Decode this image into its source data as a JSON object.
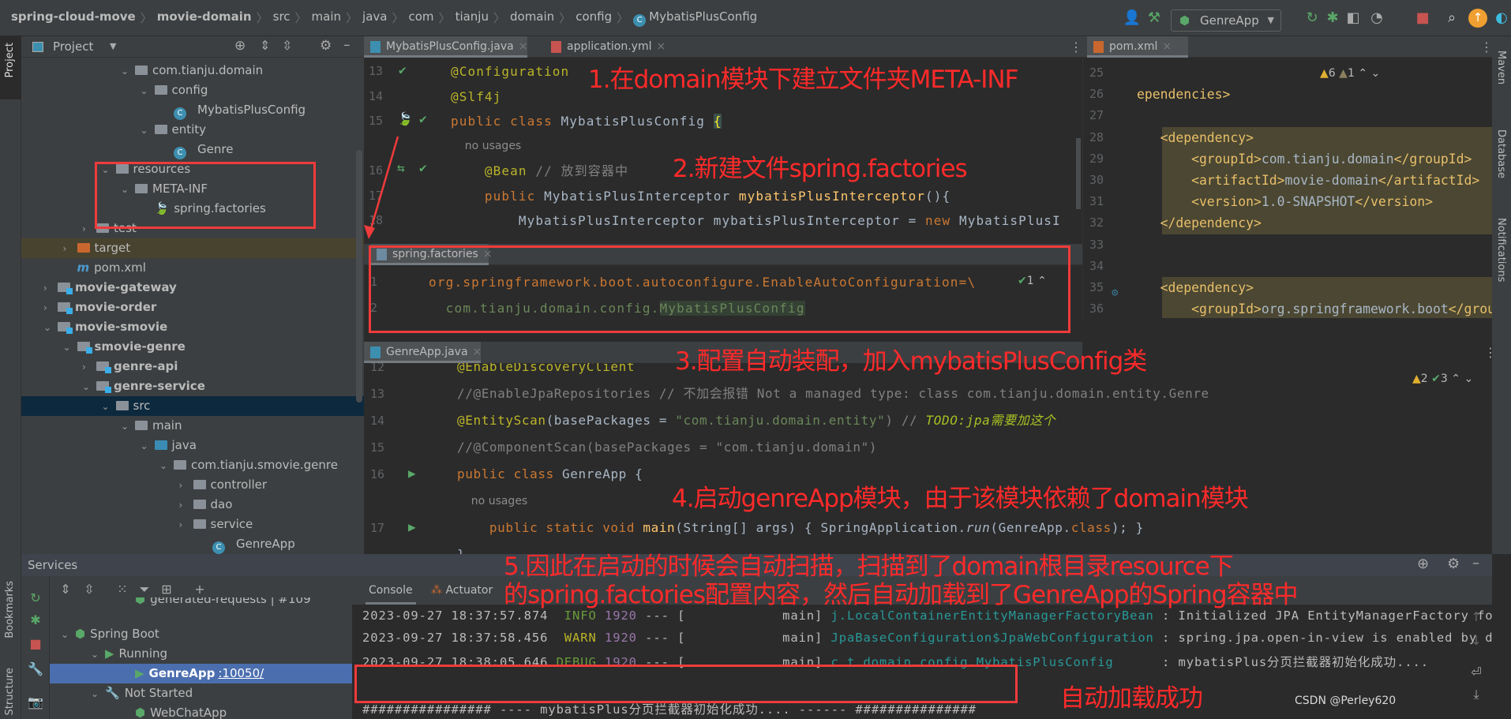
{
  "breadcrumb": [
    "spring-cloud-move",
    "movie-domain",
    "src",
    "main",
    "java",
    "com",
    "tianju",
    "domain",
    "config",
    "MybatisPlusConfig"
  ],
  "toolbar": {
    "run_config": "GenreApp"
  },
  "left_stripe": {
    "project": "Project",
    "bookmarks": "Bookmarks",
    "structure": "Structure"
  },
  "right_stripe": {
    "maven": "Maven",
    "database": "Database",
    "notifications": "Notifications"
  },
  "project_panel": {
    "title": "Project",
    "tree": [
      {
        "label": "com.tianju.domain",
        "level": 4,
        "expanded": true,
        "icon": "package"
      },
      {
        "label": "config",
        "level": 5,
        "expanded": true,
        "icon": "package"
      },
      {
        "label": "MybatisPlusConfig",
        "level": 6,
        "icon": "class"
      },
      {
        "label": "entity",
        "level": 5,
        "expanded": true,
        "icon": "package"
      },
      {
        "label": "Genre",
        "level": 6,
        "icon": "class"
      },
      {
        "label": "resources",
        "level": 3,
        "expanded": true,
        "icon": "resources-folder"
      },
      {
        "label": "META-INF",
        "level": 4,
        "expanded": true,
        "icon": "folder"
      },
      {
        "label": "spring.factories",
        "level": 5,
        "icon": "spring"
      },
      {
        "label": "test",
        "level": 2,
        "expanded": false,
        "icon": "folder"
      },
      {
        "label": "target",
        "level": 1,
        "expanded": false,
        "icon": "excluded-folder",
        "highlight": "target"
      },
      {
        "label": "pom.xml",
        "level": 1,
        "icon": "maven"
      },
      {
        "label": "movie-gateway",
        "level": 0,
        "expanded": false,
        "icon": "module",
        "bold": true
      },
      {
        "label": "movie-order",
        "level": 0,
        "expanded": false,
        "icon": "module",
        "bold": true
      },
      {
        "label": "movie-smovie",
        "level": 0,
        "expanded": true,
        "icon": "module",
        "bold": true
      },
      {
        "label": "smovie-genre",
        "level": 1,
        "expanded": true,
        "icon": "module",
        "bold": true
      },
      {
        "label": "genre-api",
        "level": 2,
        "expanded": false,
        "icon": "module",
        "bold": true
      },
      {
        "label": "genre-service",
        "level": 2,
        "expanded": true,
        "icon": "module",
        "bold": true
      },
      {
        "label": "src",
        "level": 3,
        "expanded": true,
        "icon": "folder",
        "highlight": "selected"
      },
      {
        "label": "main",
        "level": 4,
        "expanded": true,
        "icon": "folder"
      },
      {
        "label": "java",
        "level": 5,
        "expanded": true,
        "icon": "source-folder"
      },
      {
        "label": "com.tianju.smovie.genre",
        "level": 6,
        "expanded": true,
        "icon": "package"
      },
      {
        "label": "controller",
        "level": 7,
        "expanded": false,
        "icon": "package"
      },
      {
        "label": "dao",
        "level": 7,
        "expanded": false,
        "icon": "package"
      },
      {
        "label": "service",
        "level": 7,
        "expanded": false,
        "icon": "package"
      },
      {
        "label": "GenreApp",
        "level": 8,
        "icon": "spring-boot-class"
      }
    ]
  },
  "editor_top": {
    "tabs": [
      {
        "label": "MybatisPlusConfig.java",
        "active": true
      },
      {
        "label": "application.yml"
      }
    ],
    "lines": [
      {
        "num": "13",
        "tokens": [
          [
            "@Configuration",
            "ann"
          ]
        ]
      },
      {
        "num": "14",
        "tokens": [
          [
            "@Slf4j",
            "ann"
          ]
        ]
      },
      {
        "num": "15",
        "tokens": [
          [
            "public ",
            "kw"
          ],
          [
            "class ",
            "kw"
          ],
          [
            "MybatisPlusConfig ",
            "id"
          ],
          [
            "{",
            "brace"
          ]
        ]
      },
      {
        "inlay": "    no usages"
      },
      {
        "num": "16",
        "tokens": [
          [
            "    @Bean",
            "ann"
          ],
          [
            " // ",
            "cm"
          ],
          [
            "放到容器中",
            "cm"
          ]
        ]
      },
      {
        "num": "17",
        "tokens": [
          [
            "    public ",
            "kw"
          ],
          [
            "MybatisPlusInterceptor ",
            "id"
          ],
          [
            "mybatisPlusInterceptor",
            "fn"
          ],
          [
            "(){",
            "id"
          ]
        ]
      },
      {
        "num": "18",
        "tokens": [
          [
            "        MybatisPlusInterceptor mybatisPlusInterceptor = ",
            "id"
          ],
          [
            "new ",
            "kw"
          ],
          [
            "MybatisPlusI",
            "id"
          ]
        ]
      }
    ]
  },
  "editor_factories": {
    "tab": "spring.factories",
    "inspection_count": "1",
    "lines": [
      {
        "num": "1",
        "tokens": [
          [
            "org.springframework.boot.autoconfigure.EnableAutoConfiguration=\\",
            "key"
          ]
        ]
      },
      {
        "num": "2",
        "tokens": [
          [
            "  com.tianju.domain.config.",
            "val"
          ],
          [
            "MybatisPlusConfig",
            "val hlv"
          ]
        ]
      }
    ]
  },
  "editor_genre": {
    "tab": "GenreApp.java",
    "warnings": "2",
    "weak_warnings": "3",
    "lines": [
      {
        "num": "12",
        "tokens": [
          [
            "@EnableDiscoveryClient",
            "ann"
          ]
        ]
      },
      {
        "num": "13",
        "tokens": [
          [
            "//@EnableJpaRepositories // 不加会报错 Not a managed type: class com.tianju.domain.entity.Genre",
            "cm"
          ]
        ]
      },
      {
        "num": "14",
        "tokens": [
          [
            "@EntityScan",
            "ann"
          ],
          [
            "(basePackages = ",
            "id"
          ],
          [
            "\"com.tianju.domain.entity\"",
            "str"
          ],
          [
            ") // ",
            "cm"
          ],
          [
            "TODO:jpa需要加这个",
            "todo"
          ]
        ]
      },
      {
        "num": "15",
        "tokens": [
          [
            "//@ComponentScan(basePackages = \"com.tianju.domain\")",
            "cm"
          ]
        ]
      },
      {
        "num": "16",
        "tokens": [
          [
            "public ",
            "kw"
          ],
          [
            "class ",
            "kw"
          ],
          [
            "GenreApp {",
            "id"
          ]
        ]
      },
      {
        "inlay": "    no usages"
      },
      {
        "num": "17",
        "tokens": [
          [
            "    public static void ",
            "kw"
          ],
          [
            "main",
            "fn"
          ],
          [
            "(String[] args) { SpringApplication.",
            "id"
          ],
          [
            "run",
            "it"
          ],
          [
            "(GenreApp.",
            "id"
          ],
          [
            "class",
            "kw"
          ],
          [
            "); }",
            "id"
          ]
        ]
      },
      {
        "num": "",
        "tokens": [
          [
            "}",
            "id"
          ]
        ]
      }
    ]
  },
  "editor_pom": {
    "tab": "pom.xml",
    "warnings": "6",
    "weak_warnings": "1",
    "lines": [
      {
        "num": "25",
        "tokens": []
      },
      {
        "num": "26",
        "tokens": [
          [
            "ependencies>",
            "tag"
          ]
        ]
      },
      {
        "num": "27",
        "tokens": []
      },
      {
        "num": "28",
        "tokens": [
          [
            "   <dependency>",
            "tag"
          ]
        ],
        "hl": true
      },
      {
        "num": "29",
        "tokens": [
          [
            "       <groupId>",
            "tag"
          ],
          [
            "com.tianju.domain",
            "tv"
          ],
          [
            "</groupId>",
            "tag"
          ]
        ],
        "hl": true
      },
      {
        "num": "30",
        "tokens": [
          [
            "       <artifactId>",
            "tag"
          ],
          [
            "movie-domain",
            "tv"
          ],
          [
            "</artifactId>",
            "tag"
          ]
        ],
        "hl": true
      },
      {
        "num": "31",
        "tokens": [
          [
            "       <version>",
            "tag"
          ],
          [
            "1.0-SNAPSHOT",
            "tv"
          ],
          [
            "</version>",
            "tag"
          ]
        ],
        "hl": true
      },
      {
        "num": "32",
        "tokens": [
          [
            "   </dependency>",
            "tag"
          ]
        ],
        "hl": true
      },
      {
        "num": "33",
        "tokens": []
      },
      {
        "num": "34",
        "tokens": []
      },
      {
        "num": "35",
        "tokens": [
          [
            "   <dependency>",
            "tag"
          ]
        ],
        "hl": true
      },
      {
        "num": "36",
        "tokens": [
          [
            "       <groupId>",
            "tag"
          ],
          [
            "org.springframework.boot",
            "tv"
          ],
          [
            "</grou",
            "tag"
          ]
        ],
        "hl": true
      }
    ]
  },
  "annotations": {
    "step1": "1.在domain模块下建立文件夹META-INF",
    "step2": "2.新建文件spring.factories",
    "step3": "3.配置自动装配，加入mybatisPlusConfig类",
    "step4": "4.启动genreApp模块，由于该模块依赖了domain模块",
    "step5_line1": "5.因此在启动的时候会自动扫描，扫描到了domain根目录resource下",
    "step5_line2": "的spring.factories配置内容，然后自动加载到了GenreApp的Spring容器中",
    "result": "自动加载成功",
    "color": "#ff2a2a"
  },
  "services": {
    "title": "Services",
    "tree": [
      {
        "label": "generated-requests | #109",
        "level": 2
      },
      {
        "label": "Spring Boot",
        "level": 0,
        "expanded": true
      },
      {
        "label": "Running",
        "level": 1,
        "expanded": true
      },
      {
        "label": "GenreApp",
        "port": ":10050/",
        "level": 2,
        "selected": true
      },
      {
        "label": "Not Started",
        "level": 1,
        "expanded": true
      },
      {
        "label": "WebChatApp",
        "level": 2
      }
    ],
    "tabs": [
      "Console",
      "Actuator"
    ],
    "log": [
      {
        "time": "2023-09-27 18:37:57.874",
        "level": " INFO",
        "pid": "1920",
        "sep": "--- [",
        "thread": "           main]",
        "logger": "j.LocalContainerEntityManagerFactoryBean",
        "msg": ": Initialized JPA EntityManagerFactory for"
      },
      {
        "time": "2023-09-27 18:37:58.456",
        "level": " WARN",
        "pid": "1920",
        "sep": "--- [",
        "thread": "           main]",
        "logger": "JpaBaseConfiguration$JpaWebConfiguration",
        "msg": ": spring.jpa.open-in-view is enabled by de"
      },
      {
        "time": "2023-09-27 18:38:05.646",
        "level": "DEBUG",
        "pid": "1920",
        "sep": "--- [",
        "thread": "           main]",
        "logger": "c.t.domain.config.MybatisPlusConfig     ",
        "msg": ": mybatisPlus分页拦截器初始化成功...."
      }
    ],
    "banner": "################ ---- mybatisPlus分页拦截器初始化成功.... ------ ###############"
  },
  "watermark": "CSDN @Perley620"
}
